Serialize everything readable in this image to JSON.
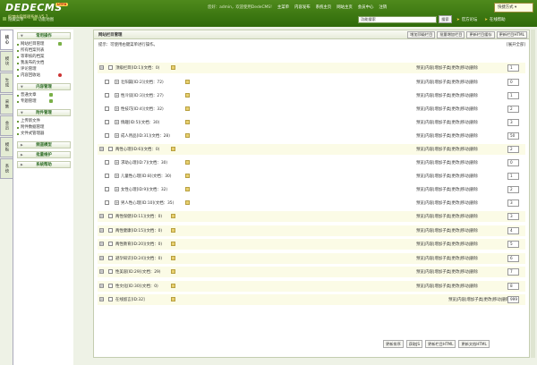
{
  "logo": {
    "brand": "DEDECMS",
    "version": "UTF8",
    "tagline": "织梦内容管理系统 V5.7"
  },
  "header": {
    "user": "您好：admin，欢迎使用DedeCMS!",
    "menu": [
      "主菜单",
      "内容发布",
      "系统主页",
      "网站主页",
      "会员中心",
      "注销"
    ],
    "quick": "快捷方式"
  },
  "subbar": {
    "buttons": [
      "隐藏菜单",
      "功能地图"
    ],
    "search_value": "功能搜索",
    "search_btn": "搜索",
    "links": [
      "官方论坛",
      "在线帮助"
    ]
  },
  "vtabs": [
    "核心",
    "模块",
    "生成",
    "采集",
    "会员",
    "模板",
    "系统"
  ],
  "sidebar": {
    "groups": [
      {
        "title": "常用操作",
        "items": [
          {
            "label": "网站栏目管理",
            "icon": "green"
          },
          {
            "label": "所有档案列表",
            "icon": ""
          },
          {
            "label": "等审核的档案",
            "icon": ""
          },
          {
            "label": "我发布的文档",
            "icon": ""
          },
          {
            "label": "评论管理",
            "icon": ""
          },
          {
            "label": "内容回收站",
            "icon": "red"
          }
        ]
      },
      {
        "title": "内容管理",
        "items": [
          {
            "label": "普通文章",
            "icon": "green"
          },
          {
            "label": "专题管理",
            "icon": "green"
          }
        ]
      },
      {
        "title": "附件管理",
        "items": [
          {
            "label": "上传新文件",
            "icon": ""
          },
          {
            "label": "附件数据管理",
            "icon": ""
          },
          {
            "label": "文件式管理器",
            "icon": ""
          }
        ]
      },
      {
        "title": "频道模型",
        "items": []
      },
      {
        "title": "批量维护",
        "items": []
      },
      {
        "title": "系统帮助",
        "items": []
      }
    ]
  },
  "main": {
    "title": "网站栏目管理",
    "buttons": [
      "增加顶级栏目",
      "批量增加栏目",
      "更新栏目缓存",
      "更新栏目HTML"
    ],
    "hint": "提示：可使用右键菜单进行操作。",
    "expand": "[展开全部]",
    "actions": "预览|内容|增加子类|更改|移动|删除",
    "rows": [
      {
        "name": "顶级栏目[ID:1](文档：0)",
        "level": 0,
        "order": "1"
      },
      {
        "name": "壮阳篇[ID:2](文档：72)",
        "level": 1,
        "order": "0"
      },
      {
        "name": "性冷谈[ID:3](文档：27)",
        "level": 1,
        "order": "1"
      },
      {
        "name": "性技巧[ID:4](文档：32)",
        "level": 1,
        "order": "2"
      },
      {
        "name": "情趣[ID:5](文档：30)",
        "level": 1,
        "order": "3"
      },
      {
        "name": "成人用品[ID:31](文档：28)",
        "level": 1,
        "order": "50"
      },
      {
        "name": "两性心理[ID:6](文档：0)",
        "level": 0,
        "order": "2"
      },
      {
        "name": "求助心理[ID:7](文档：30)",
        "level": 1,
        "order": "0"
      },
      {
        "name": "儿童性心理[ID:8](文档：30)",
        "level": 1,
        "order": "1"
      },
      {
        "name": "女性心理[ID:9](文档：32)",
        "level": 1,
        "order": "2"
      },
      {
        "name": "男人性心理[ID:10](文档：35)",
        "level": 1,
        "order": "3"
      },
      {
        "name": "两性保健[ID:11](文档：0)",
        "level": 0,
        "order": "3"
      },
      {
        "name": "两性健康[ID:15](文档：0)",
        "level": 0,
        "order": "4"
      },
      {
        "name": "两性教育[ID:20](文档：0)",
        "level": 0,
        "order": "5"
      },
      {
        "name": "避孕知识[ID:24](文档：0)",
        "level": 0,
        "order": "6"
      },
      {
        "name": "性美容[ID:29](文档：29)",
        "level": 0,
        "order": "7"
      },
      {
        "name": "性文化[ID:30](文档：0)",
        "level": 0,
        "order": "8"
      },
      {
        "name": "在线留言[ID:32]",
        "level": 0,
        "order": "999"
      }
    ],
    "bottom_buttons": [
      "更新排序",
      "获取JS",
      "更新栏目HTML",
      "更新文档HTML"
    ]
  }
}
